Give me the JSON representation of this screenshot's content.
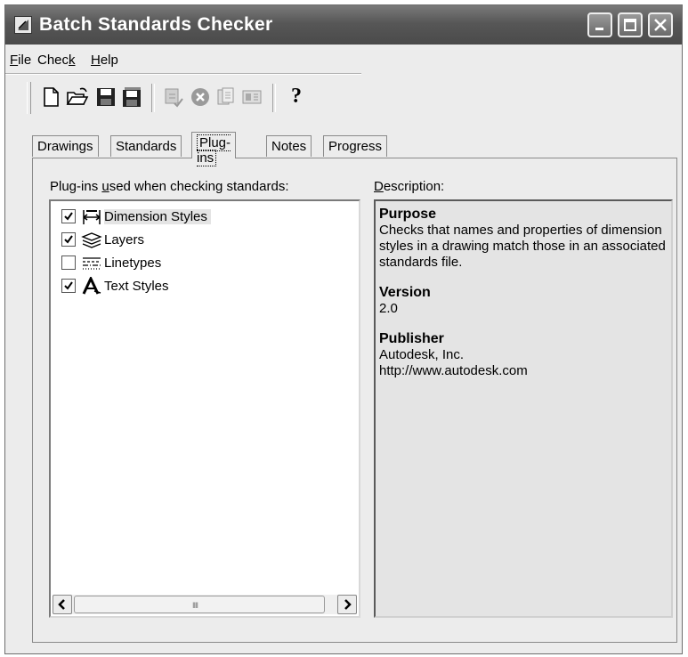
{
  "window": {
    "title": "Batch Standards Checker",
    "controls": [
      "minimize",
      "maximize",
      "close"
    ]
  },
  "menu": {
    "items": [
      {
        "pre": "",
        "key": "F",
        "post": "ile"
      },
      {
        "pre": "Chec",
        "key": "k",
        "post": ""
      },
      {
        "pre": "",
        "key": "H",
        "post": "elp"
      }
    ]
  },
  "toolbar": {
    "icons": [
      "new-icon",
      "open-icon",
      "save-icon",
      "save-as-icon",
      "check-icon",
      "stop-icon",
      "copy-icon",
      "options-icon",
      "help-icon"
    ],
    "help_label": "?"
  },
  "tabs": [
    {
      "label": "Drawings",
      "active": false
    },
    {
      "label": "Standards",
      "active": false
    },
    {
      "label": "Plug-ins",
      "active": true
    },
    {
      "label": "Notes",
      "active": false
    },
    {
      "label": "Progress",
      "active": false
    }
  ],
  "plugins": {
    "label_pre": "Plug-ins ",
    "label_key": "u",
    "label_post": "sed when checking standards:",
    "items": [
      {
        "label": "Dimension Styles",
        "checked": true,
        "icon": "dimension-styles-icon",
        "selected": true
      },
      {
        "label": "Layers",
        "checked": true,
        "icon": "layers-icon",
        "selected": false
      },
      {
        "label": "Linetypes",
        "checked": false,
        "icon": "linetypes-icon",
        "selected": false
      },
      {
        "label": "Text Styles",
        "checked": true,
        "icon": "text-styles-icon",
        "selected": false
      }
    ],
    "scroll_grip": "IIII"
  },
  "description": {
    "label_key": "D",
    "label_post": "escription:",
    "purpose_heading": "Purpose",
    "purpose_text": "Checks that names and properties of dimension styles in a drawing match those in an associated standards file.",
    "version_heading": "Version",
    "version_value": "2.0",
    "publisher_heading": "Publisher",
    "publisher_name": "Autodesk, Inc.",
    "publisher_url": "http://www.autodesk.com"
  }
}
